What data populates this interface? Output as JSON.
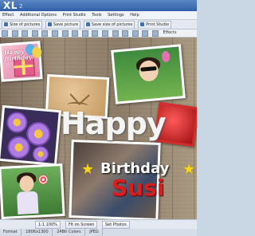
{
  "titlebar": {
    "logo": "XL",
    "version": "2"
  },
  "menu": [
    "Effect",
    "Additional Options",
    "Print Studio",
    "Tools",
    "Settings",
    "Help"
  ],
  "toolbar": {
    "buttons": [
      "Size of pictures",
      "Save picture",
      "Save size of pictures",
      "Print Studio"
    ]
  },
  "toolbar2": {
    "effects_label": "Effects"
  },
  "canvas": {
    "gift_text": "Happy Birthday!",
    "happy": "Happy",
    "birthday": "Birthday",
    "name": "Susi",
    "star_glyph": "★"
  },
  "bottombar": {
    "zoom": "1:1 100%",
    "fit": "Fit on Screen",
    "set_photos": "Set Photos"
  },
  "statusbar": {
    "format": "Format",
    "size": "1806x1300",
    "colors": "24Bit Colors",
    "type": "JPEG"
  },
  "colors": {
    "titlebar": "#2f5fa7",
    "susi": "#d81f1f",
    "star": "#f7d517"
  }
}
